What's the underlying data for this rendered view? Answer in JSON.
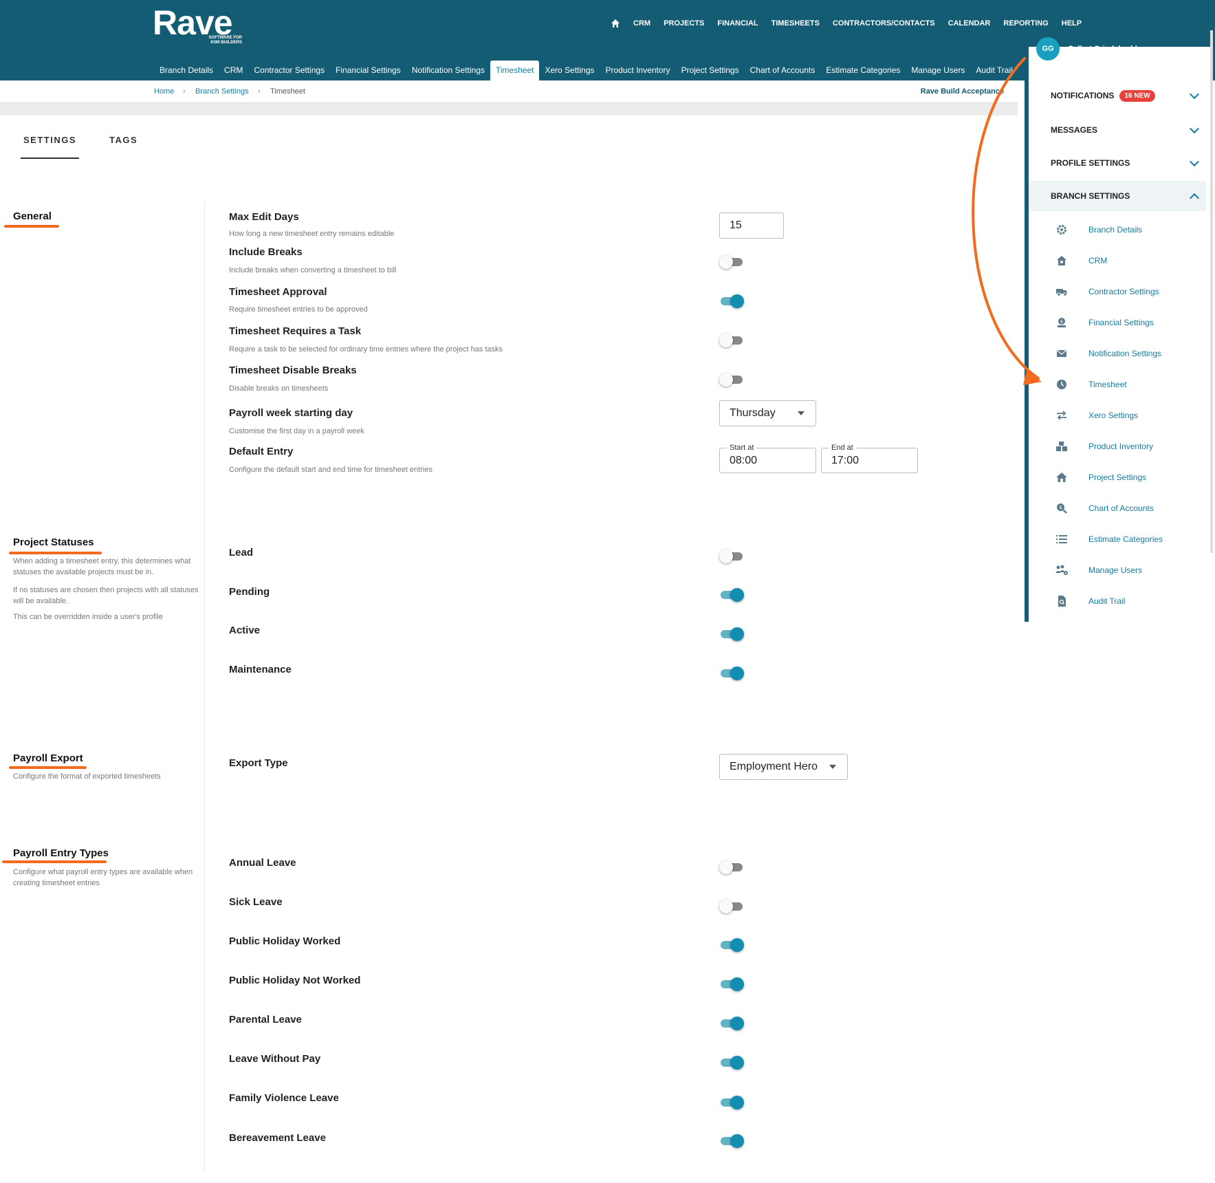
{
  "header": {
    "logo": {
      "name": "Rave",
      "tagline_line1": "SOFTWARE FOR",
      "tagline_line2": "KIWI BUILDERS"
    },
    "top_nav": [
      "CRM",
      "PROJECTS",
      "FINANCIAL",
      "TIMESHEETS",
      "CONTRACTORS/CONTACTS",
      "CALENDAR",
      "REPORTING",
      "HELP"
    ],
    "sub_nav": [
      "Branch Details",
      "CRM",
      "Contractor Settings",
      "Financial Settings",
      "Notification Settings",
      "Timesheet",
      "Xero Settings",
      "Product Inventory",
      "Project Settings",
      "Chart of Accounts",
      "Estimate Categories",
      "Manage Users",
      "Audit Trail"
    ],
    "active_sub_nav": "Timesheet",
    "brand_color": "#135c73",
    "accent_color": "#137ba0"
  },
  "breadcrumb": {
    "home": "Home",
    "branch_settings": "Branch Settings",
    "current": "Timesheet",
    "right_link": "Rave Build Acceptance"
  },
  "tabs": {
    "settings": "SETTINGS",
    "tags": "TAGS"
  },
  "general": {
    "title": "General",
    "max_edit_days": {
      "label": "Max Edit Days",
      "desc": "How long a new timesheet entry remains editable",
      "value": "15"
    },
    "include_breaks": {
      "label": "Include Breaks",
      "desc": "Include breaks when converting a timesheet to bill",
      "on": false
    },
    "timesheet_approval": {
      "label": "Timesheet Approval",
      "desc": "Require timesheet entries to be approved",
      "on": true
    },
    "requires_task": {
      "label": "Timesheet Requires a Task",
      "desc": "Require a task to be selected for ordinary time entries where the project has tasks",
      "on": false
    },
    "disable_breaks": {
      "label": "Timesheet Disable Breaks",
      "desc": "Disable breaks on timesheets",
      "on": false
    },
    "payroll_week": {
      "label": "Payroll week starting day",
      "desc": "Customise the first day in a payroll week",
      "value": "Thursday"
    },
    "default_entry": {
      "label": "Default Entry",
      "desc": "Configure the default start and end time for timesheet entries",
      "start_label": "Start at",
      "start_value": "08:00",
      "end_label": "End at",
      "end_value": "17:00"
    }
  },
  "project_statuses": {
    "title": "Project Statuses",
    "desc1": "When adding a timesheet entry, this determines what statuses the available projects must be in.",
    "desc2": "If no statuses are chosen then projects with all statuses will be available.",
    "desc3": "This can be overridden inside a user's profile",
    "items": [
      {
        "label": "Lead",
        "on": false
      },
      {
        "label": "Pending",
        "on": true
      },
      {
        "label": "Active",
        "on": true
      },
      {
        "label": "Maintenance",
        "on": true
      }
    ]
  },
  "payroll_export": {
    "title": "Payroll Export",
    "desc": "Configure the format of exported timesheets",
    "export_type": {
      "label": "Export Type",
      "value": "Employment Hero"
    }
  },
  "payroll_entry_types": {
    "title": "Payroll Entry Types",
    "desc": "Configure what payroll entry types are available when creating timesheet entries",
    "items": [
      {
        "label": "Annual Leave",
        "on": false
      },
      {
        "label": "Sick Leave",
        "on": false
      },
      {
        "label": "Public Holiday Worked",
        "on": true
      },
      {
        "label": "Public Holiday Not Worked",
        "on": true
      },
      {
        "label": "Parental Leave",
        "on": true
      },
      {
        "label": "Leave Without Pay",
        "on": true
      },
      {
        "label": "Family Violence Leave",
        "on": true
      },
      {
        "label": "Bereavement Leave",
        "on": true
      }
    ]
  },
  "user_panel": {
    "initials": "GG",
    "name": "Gellert Grindelwald",
    "notifications": "NOTIFICATIONS",
    "notifications_badge": "16 NEW",
    "messages": "MESSAGES",
    "profile_settings": "PROFILE SETTINGS",
    "branch_settings": "BRANCH SETTINGS",
    "branch_items": [
      {
        "icon": "gear-icon",
        "label": "Branch Details"
      },
      {
        "icon": "crm-house-icon",
        "label": "CRM"
      },
      {
        "icon": "truck-icon",
        "label": "Contractor Settings"
      },
      {
        "icon": "money-bag-icon",
        "label": "Financial Settings"
      },
      {
        "icon": "envelope-icon",
        "label": "Notification Settings"
      },
      {
        "icon": "clock-icon",
        "label": "Timesheet"
      },
      {
        "icon": "swap-arrows-icon",
        "label": "Xero Settings"
      },
      {
        "icon": "boxes-icon",
        "label": "Product Inventory"
      },
      {
        "icon": "home-icon",
        "label": "Project Settings"
      },
      {
        "icon": "search-dollar-icon",
        "label": "Chart of Accounts"
      },
      {
        "icon": "list-icon",
        "label": "Estimate Categories"
      },
      {
        "icon": "users-gear-icon",
        "label": "Manage Users"
      },
      {
        "icon": "file-search-icon",
        "label": "Audit Trail"
      }
    ]
  },
  "annotation_color": "#f36a1c"
}
